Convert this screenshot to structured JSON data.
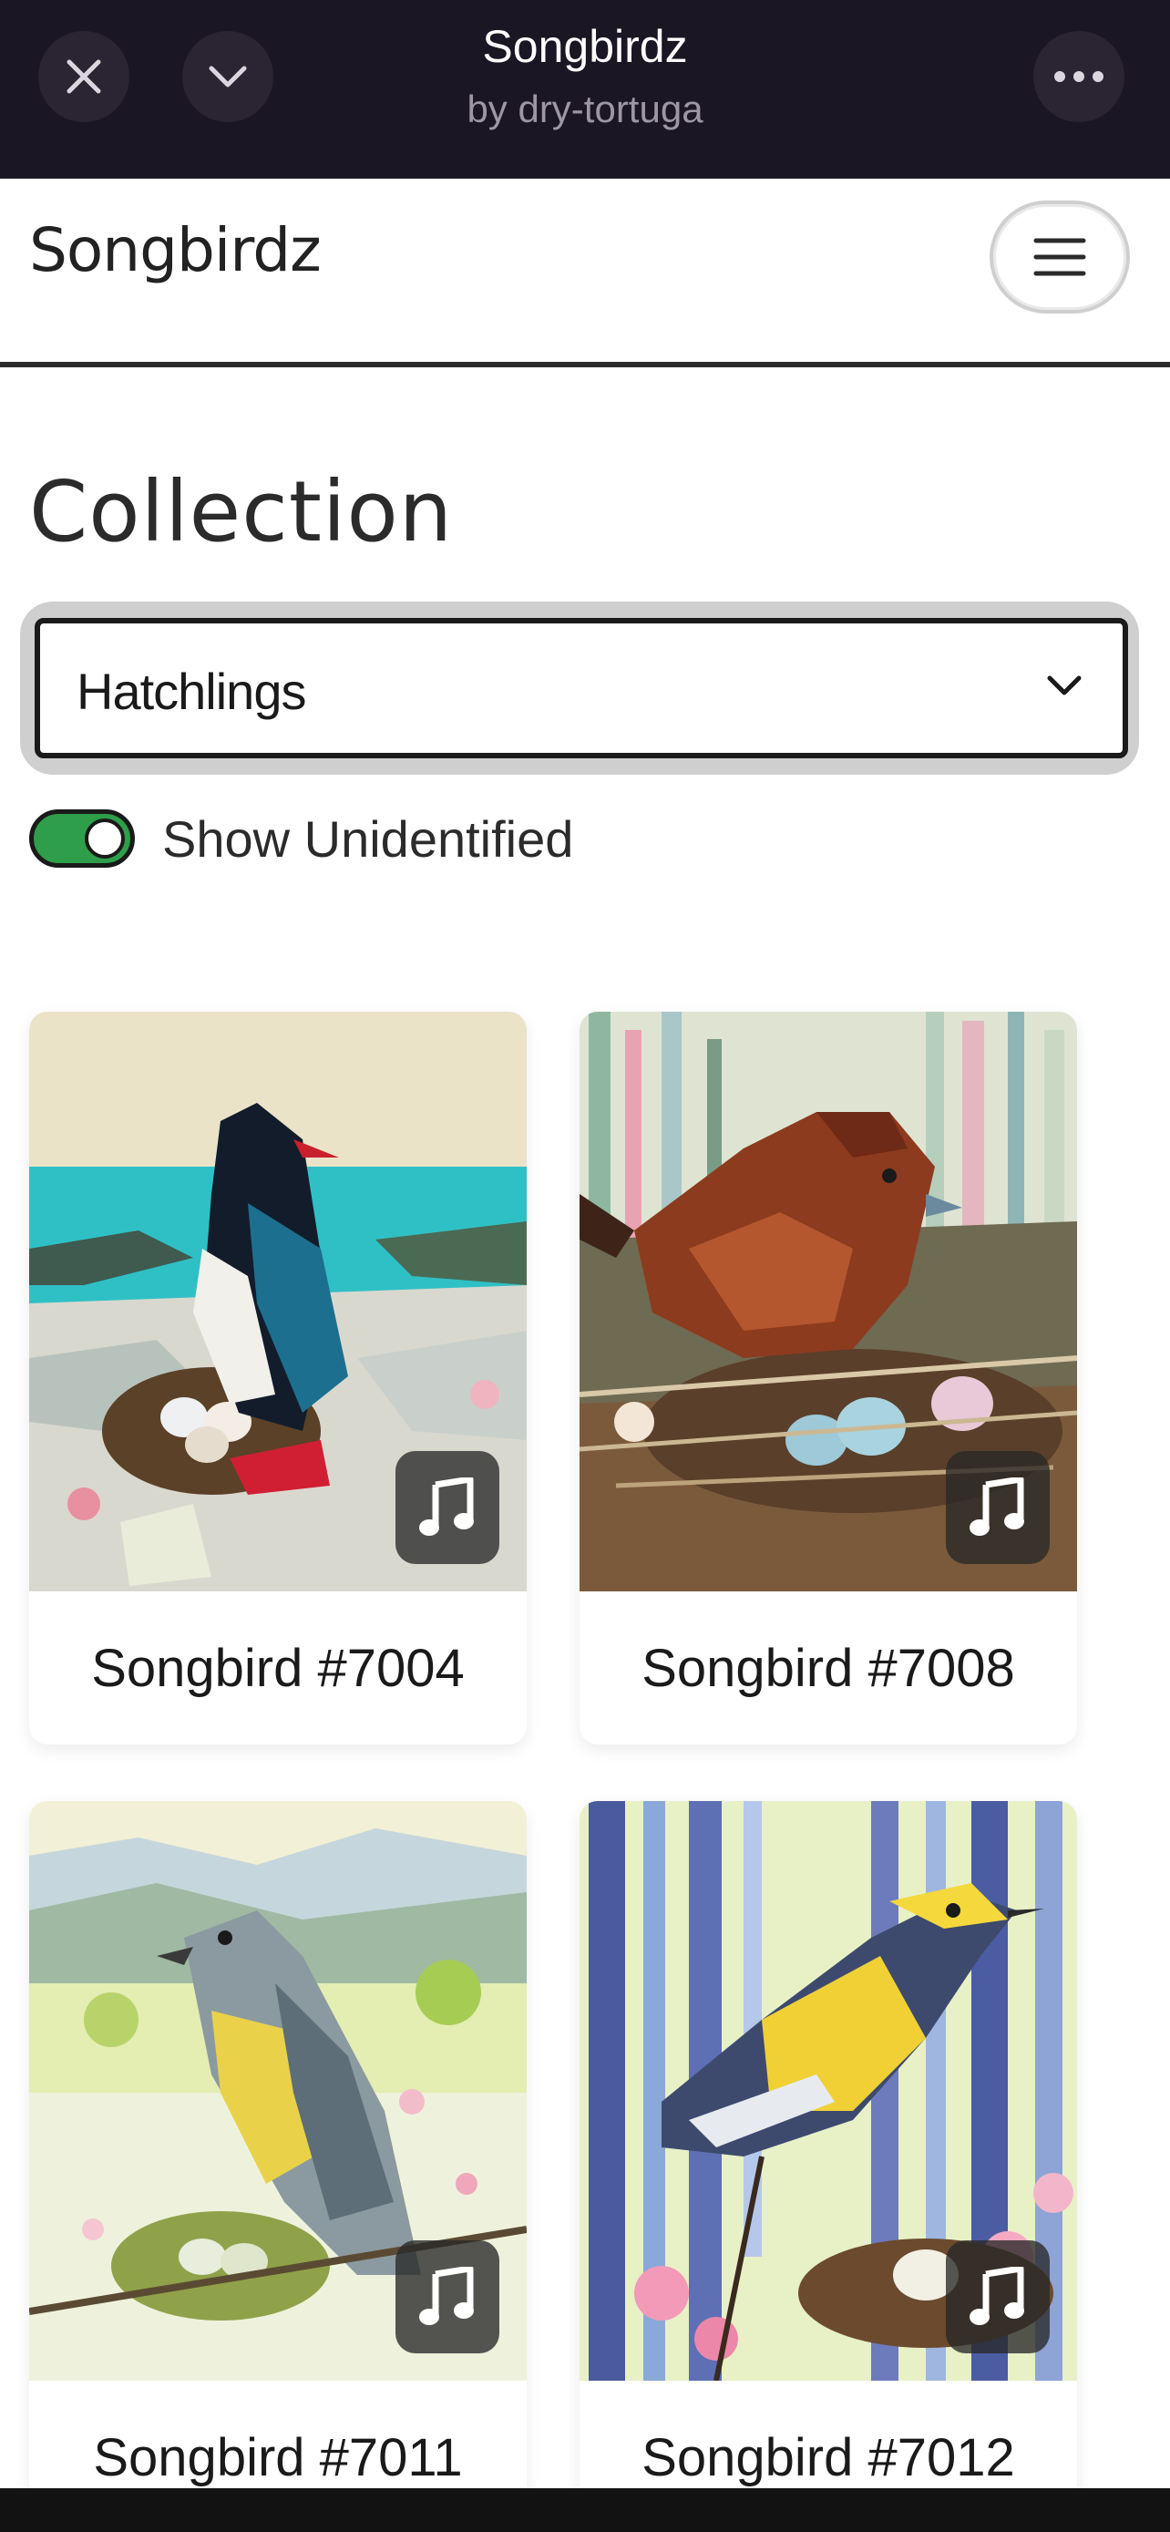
{
  "topbar": {
    "title": "Songbirdz",
    "subtitle": "by dry-tortuga"
  },
  "header": {
    "brand": "Songbirdz"
  },
  "collection": {
    "title": "Collection",
    "selected": "Hatchlings",
    "toggle_label": "Show Unidentified",
    "toggle_on": true
  },
  "cards": [
    {
      "label": "Songbird #7004"
    },
    {
      "label": "Songbird #7008"
    },
    {
      "label": "Songbird #7011"
    },
    {
      "label": "Songbird #7012"
    }
  ],
  "colors": {
    "topbar_bg": "#1b1623",
    "toggle_on": "#2e9e4a"
  }
}
